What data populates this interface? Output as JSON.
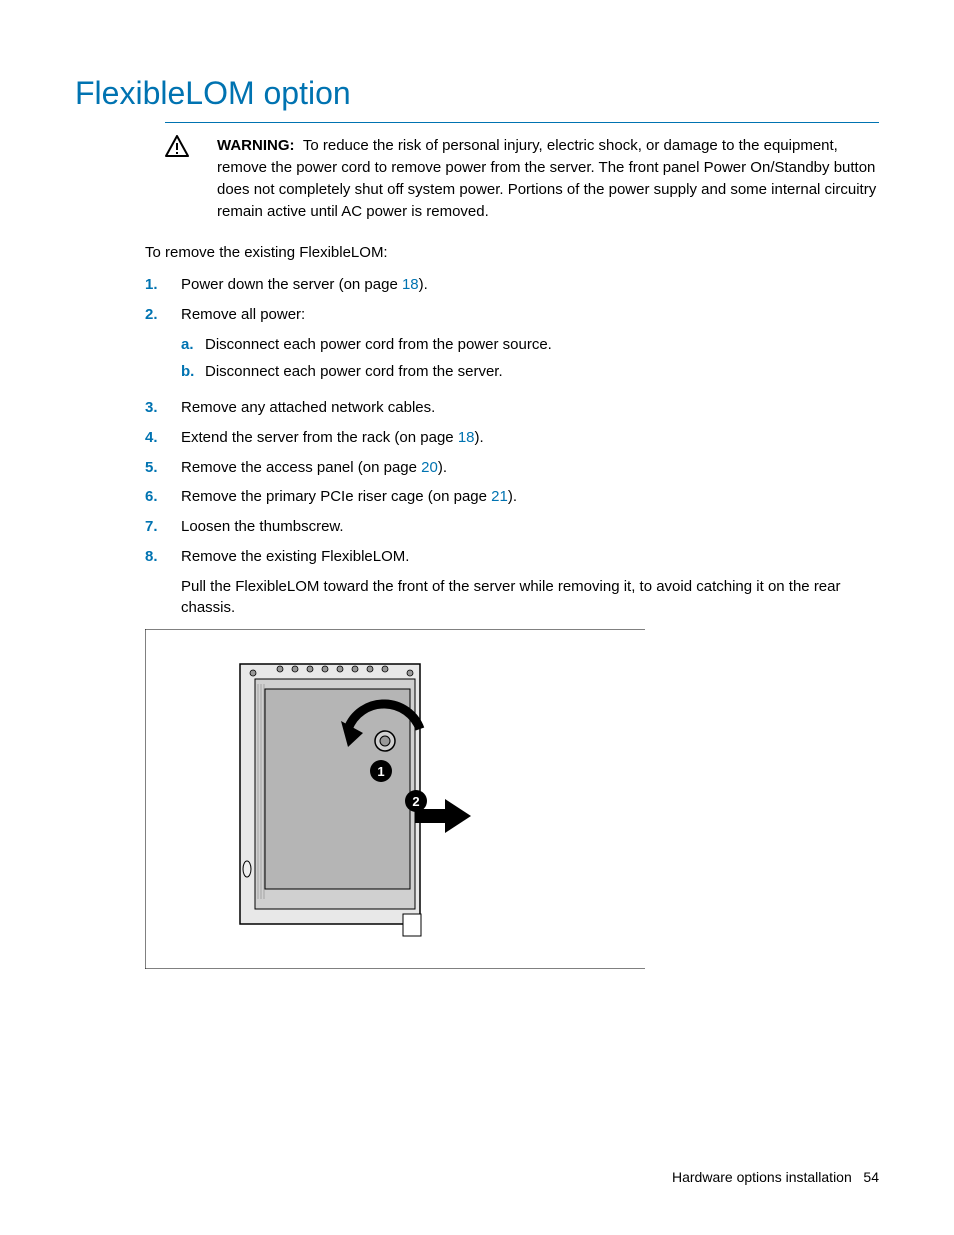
{
  "heading": "FlexibleLOM option",
  "warning": {
    "label": "WARNING:",
    "text": "To reduce the risk of personal injury, electric shock, or damage to the equipment, remove the power cord to remove power from the server. The front panel Power On/Standby button does not completely shut off system power. Portions of the power supply and some internal circuitry remain active until AC power is removed."
  },
  "intro": "To remove the existing FlexibleLOM:",
  "steps": [
    {
      "num": "1.",
      "text_before": "Power down the server (on page ",
      "link": "18",
      "text_after": ")."
    },
    {
      "num": "2.",
      "text_before": "Remove all power:",
      "subs": [
        {
          "num": "a.",
          "text": "Disconnect each power cord from the power source."
        },
        {
          "num": "b.",
          "text": "Disconnect each power cord from the server."
        }
      ]
    },
    {
      "num": "3.",
      "text_before": "Remove any attached network cables."
    },
    {
      "num": "4.",
      "text_before": "Extend the server from the rack (on page ",
      "link": "18",
      "text_after": ")."
    },
    {
      "num": "5.",
      "text_before": "Remove the access panel (on page ",
      "link": "20",
      "text_after": ")."
    },
    {
      "num": "6.",
      "text_before": "Remove the primary PCIe riser cage (on page ",
      "link": "21",
      "text_after": ")."
    },
    {
      "num": "7.",
      "text_before": "Loosen the thumbscrew."
    },
    {
      "num": "8.",
      "text_before": "Remove the existing FlexibleLOM.",
      "continuation": "Pull the FlexibleLOM toward the front of the server while removing it, to avoid catching it on the rear chassis."
    }
  ],
  "footer": {
    "section": "Hardware options installation",
    "page": "54"
  }
}
